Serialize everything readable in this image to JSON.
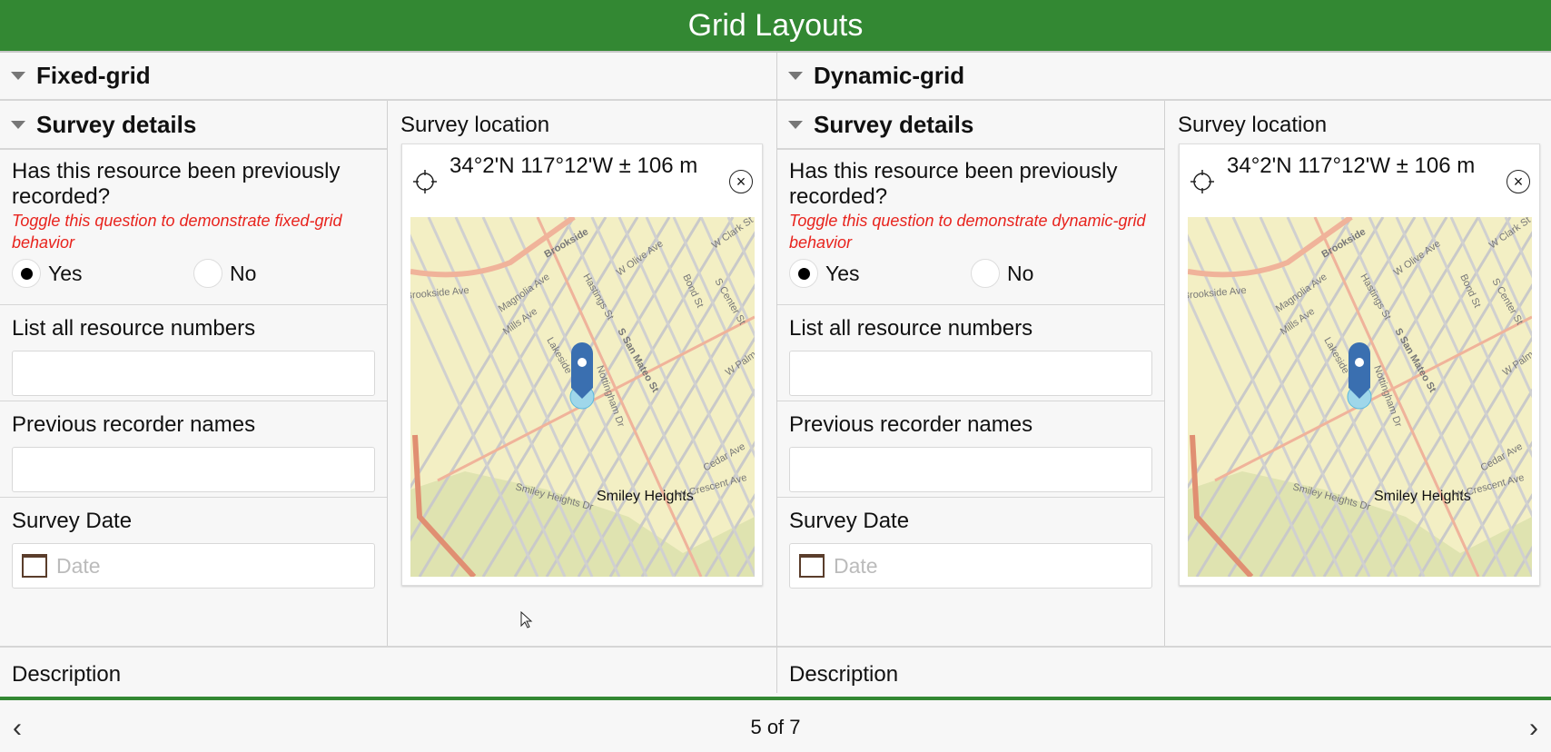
{
  "header": {
    "title": "Grid Layouts"
  },
  "panels": [
    {
      "group": "Fixed-grid",
      "section": "Survey details",
      "question": "Has this resource been previously recorded?",
      "hint": "Toggle this question to demonstrate fixed-grid behavior",
      "options": [
        "Yes",
        "No"
      ],
      "selected": "Yes",
      "resource_label": "List all resource numbers",
      "resource_value": "",
      "recorder_label": "Previous recorder names",
      "recorder_value": "",
      "date_label": "Survey Date",
      "date_placeholder": "Date",
      "location_label": "Survey location",
      "location_value": "34°2'N 117°12'W ± 106 m",
      "description_label": "Description",
      "description_value": ""
    },
    {
      "group": "Dynamic-grid",
      "section": "Survey details",
      "question": "Has this resource been previously recorded?",
      "hint": "Toggle this question to demonstrate dynamic-grid behavior",
      "options": [
        "Yes",
        "No"
      ],
      "selected": "Yes",
      "resource_label": "List all resource numbers",
      "resource_value": "",
      "recorder_label": "Previous recorder names",
      "recorder_value": "",
      "date_label": "Survey Date",
      "date_placeholder": "Date",
      "location_label": "Survey location",
      "location_value": "34°2'N 117°12'W ± 106 m",
      "description_label": "Description",
      "description_value": ""
    }
  ],
  "map": {
    "place": "Smiley Heights",
    "streets": [
      "Brookside",
      "Magnolia Ave",
      "Mills Ave",
      "Hastings St",
      "W Olive Ave",
      "Bond St",
      "S Center St",
      "W Clark St",
      "S San Mateo St",
      "Lakeside",
      "Nottingham Dr",
      "W Palm",
      "Cedar Ave",
      "W Crescent Ave",
      "Smiley Heights Dr",
      "Brookside Ave"
    ]
  },
  "colors": {
    "accent": "#338833",
    "hint": "#e8231d",
    "pin": "#3a6fb0"
  },
  "footer": {
    "page": "5 of 7",
    "prev": "‹",
    "next": "›"
  }
}
